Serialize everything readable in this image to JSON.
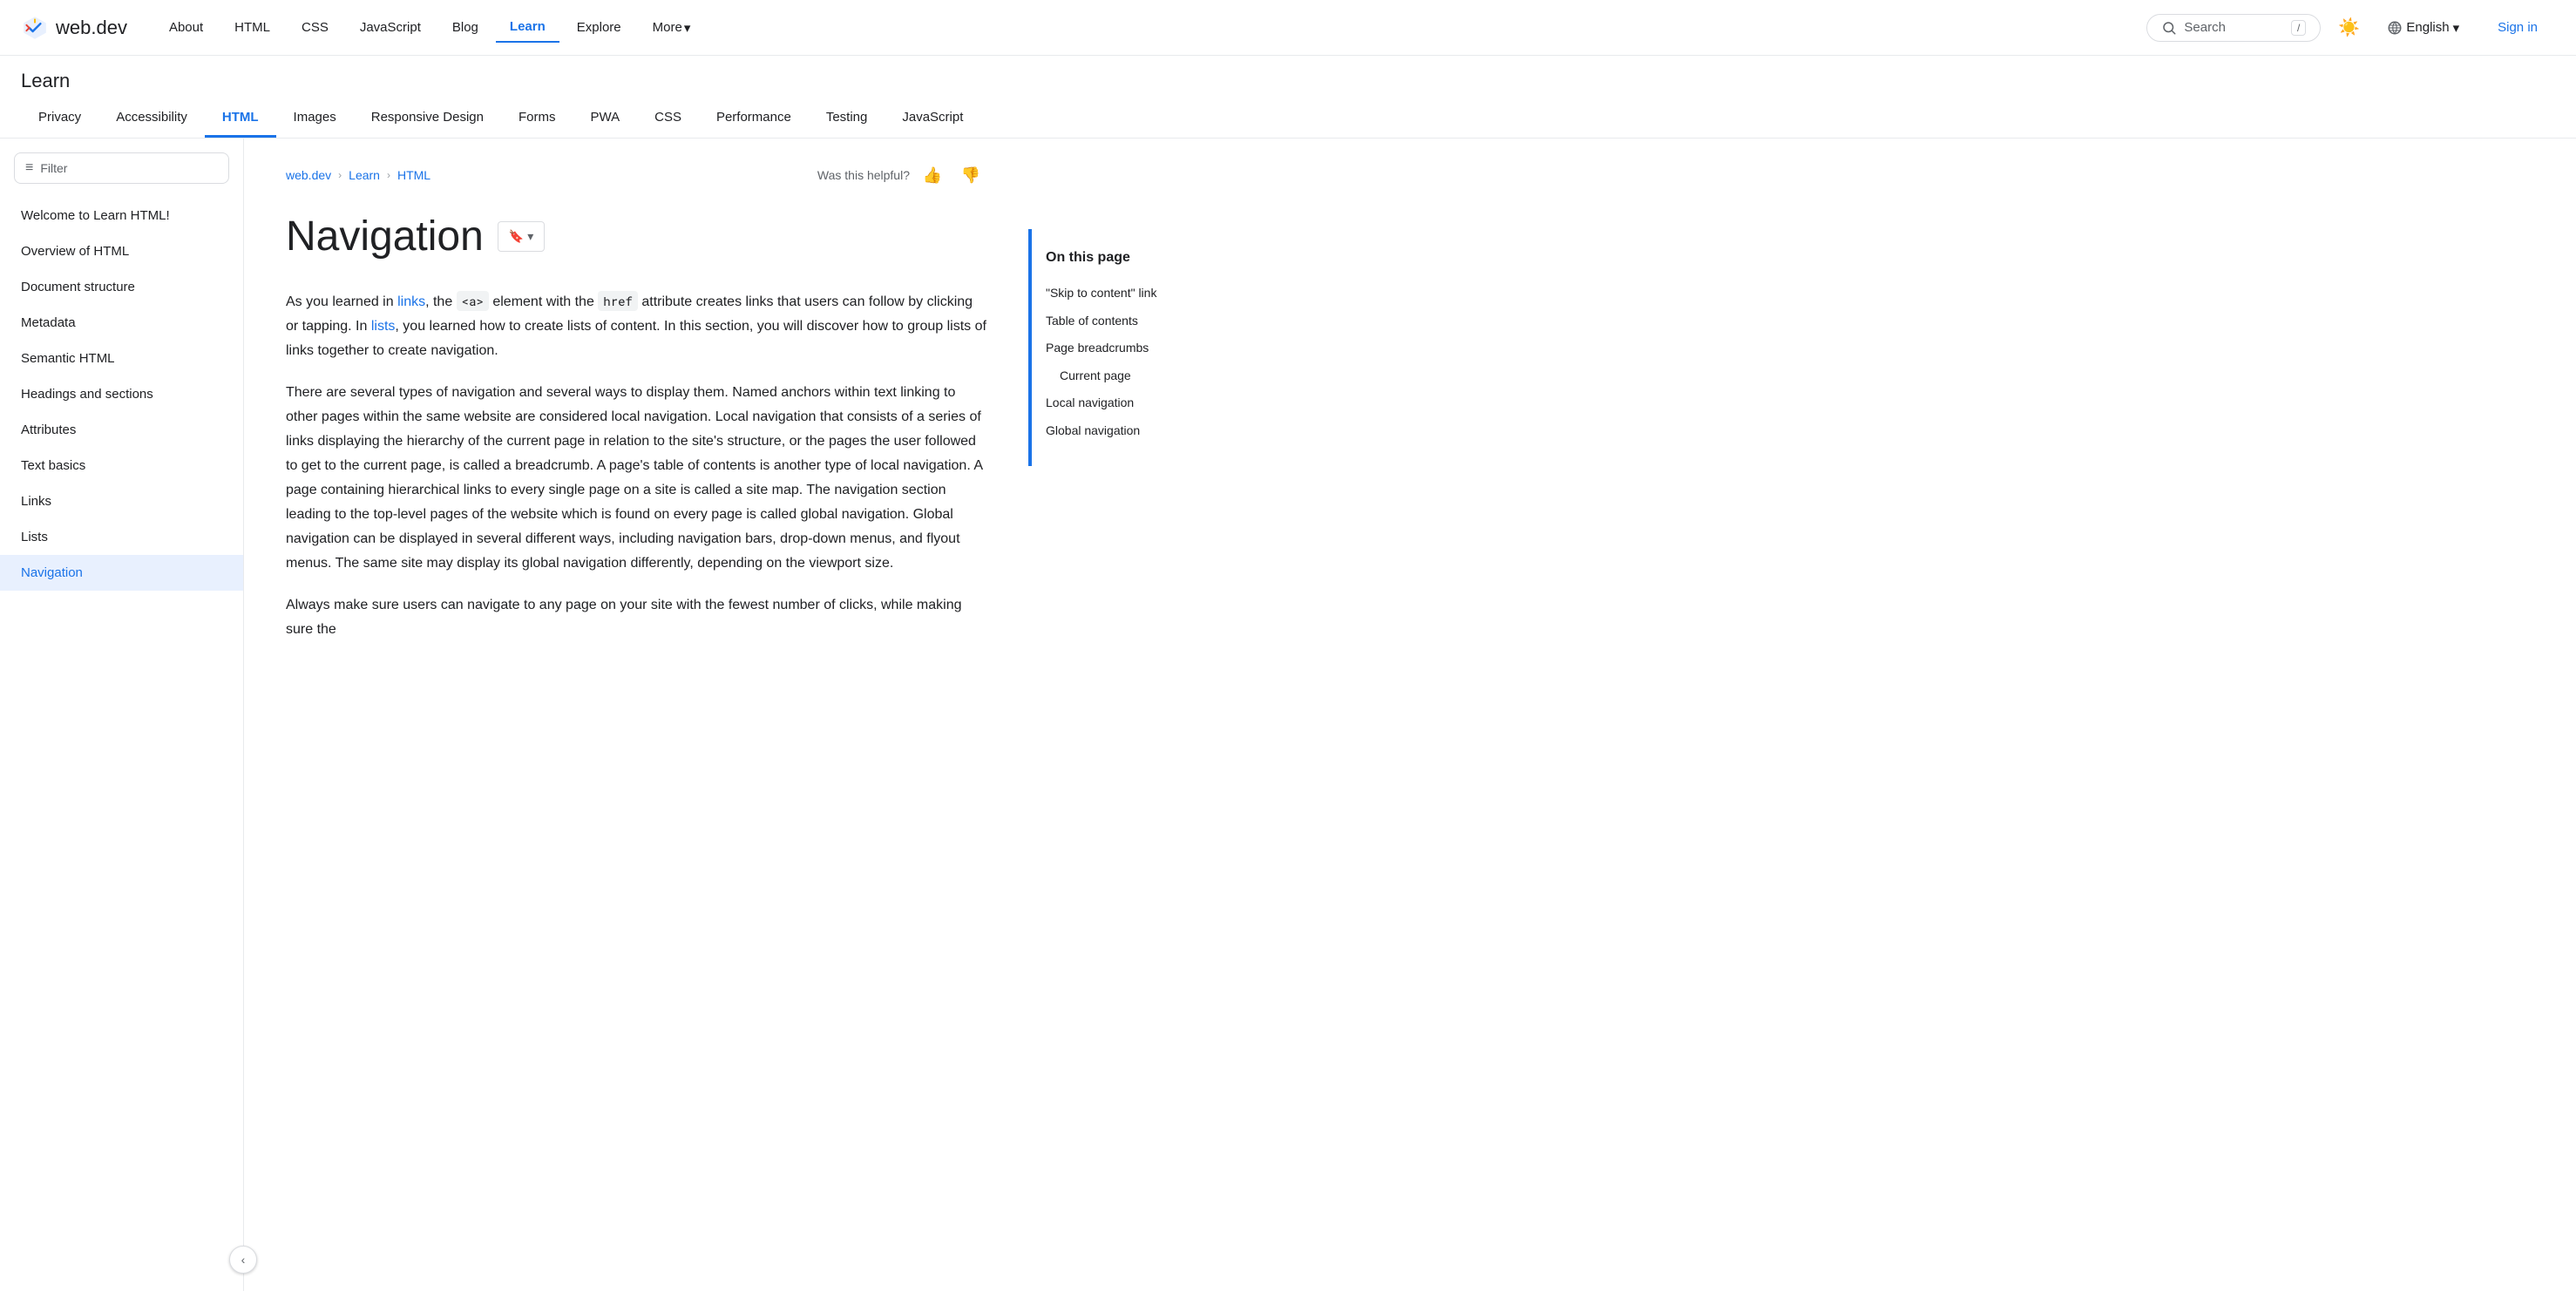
{
  "topNav": {
    "logoText": "web.dev",
    "links": [
      {
        "label": "About",
        "active": false
      },
      {
        "label": "HTML",
        "active": false
      },
      {
        "label": "CSS",
        "active": false
      },
      {
        "label": "JavaScript",
        "active": false
      },
      {
        "label": "Blog",
        "active": false
      },
      {
        "label": "Learn",
        "active": true
      },
      {
        "label": "Explore",
        "active": false
      },
      {
        "label": "More",
        "active": false,
        "hasDropdown": true
      }
    ],
    "search": {
      "placeholder": "Search",
      "shortcut": "/"
    },
    "language": "English",
    "signIn": "Sign in"
  },
  "learnSection": {
    "title": "Learn",
    "tabs": [
      {
        "label": "Privacy",
        "active": false
      },
      {
        "label": "Accessibility",
        "active": false
      },
      {
        "label": "HTML",
        "active": true
      },
      {
        "label": "Images",
        "active": false
      },
      {
        "label": "Responsive Design",
        "active": false
      },
      {
        "label": "Forms",
        "active": false
      },
      {
        "label": "PWA",
        "active": false
      },
      {
        "label": "CSS",
        "active": false
      },
      {
        "label": "Performance",
        "active": false
      },
      {
        "label": "Testing",
        "active": false
      },
      {
        "label": "JavaScript",
        "active": false
      }
    ]
  },
  "sidebar": {
    "filterPlaceholder": "Filter",
    "items": [
      {
        "label": "Welcome to Learn HTML!",
        "active": false
      },
      {
        "label": "Overview of HTML",
        "active": false
      },
      {
        "label": "Document structure",
        "active": false
      },
      {
        "label": "Metadata",
        "active": false
      },
      {
        "label": "Semantic HTML",
        "active": false
      },
      {
        "label": "Headings and sections",
        "active": false
      },
      {
        "label": "Attributes",
        "active": false
      },
      {
        "label": "Text basics",
        "active": false
      },
      {
        "label": "Links",
        "active": false
      },
      {
        "label": "Lists",
        "active": false
      },
      {
        "label": "Navigation",
        "active": true
      }
    ],
    "collapseLabel": "‹"
  },
  "breadcrumb": {
    "items": [
      {
        "label": "web.dev",
        "href": "#"
      },
      {
        "label": "Learn",
        "href": "#"
      },
      {
        "label": "HTML",
        "href": "#"
      }
    ],
    "separator": "›",
    "helpfulText": "Was this helpful?",
    "thumbUpLabel": "👍",
    "thumbDownLabel": "👎"
  },
  "article": {
    "title": "Navigation",
    "bookmarkLabel": "🔖",
    "bookmarkDropdown": "▾",
    "paragraphs": [
      "As you learned in links, the <a> element with the href attribute creates links that users can follow by clicking or tapping. In lists, you learned how to create lists of content. In this section, you will discover how to group lists of links together to create navigation.",
      "There are several types of navigation and several ways to display them. Named anchors within text linking to other pages within the same website are considered local navigation. Local navigation that consists of a series of links displaying the hierarchy of the current page in relation to the site's structure, or the pages the user followed to get to the current page, is called a breadcrumb. A page's table of contents is another type of local navigation. A page containing hierarchical links to every single page on a site is called a site map. The navigation section leading to the top-level pages of the website which is found on every page is called global navigation. Global navigation can be displayed in several different ways, including navigation bars, drop-down menus, and flyout menus. The same site may display its global navigation differently, depending on the viewport size.",
      "Always make sure users can navigate to any page on your site with the fewest number of clicks, while making sure the"
    ],
    "inlineCode": {
      "a": "<a>",
      "href": "href"
    },
    "inlineLinks": {
      "links": "links",
      "lists": "lists"
    }
  },
  "onThisPage": {
    "title": "On this page",
    "items": [
      {
        "label": "\"Skip to content\" link",
        "sub": false
      },
      {
        "label": "Table of contents",
        "sub": false
      },
      {
        "label": "Page breadcrumbs",
        "sub": false
      },
      {
        "label": "Current page",
        "sub": true
      },
      {
        "label": "Local navigation",
        "sub": false
      },
      {
        "label": "Global navigation",
        "sub": false
      }
    ]
  }
}
